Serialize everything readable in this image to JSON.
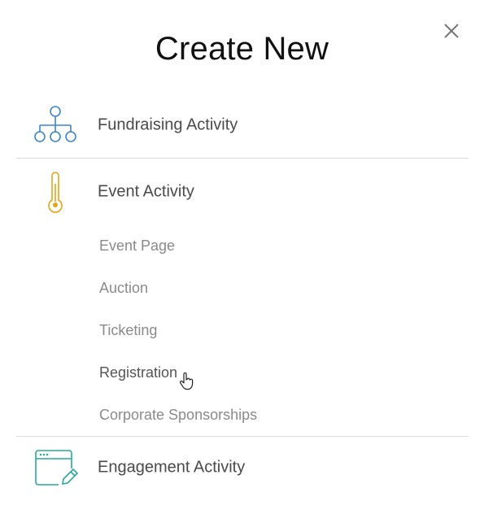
{
  "dialog": {
    "title": "Create New",
    "close_icon": "close-icon"
  },
  "options": [
    {
      "label": "Fundraising Activity",
      "icon": "org-chart-icon",
      "icon_color": "#3a86c8"
    },
    {
      "label": "Event Activity",
      "icon": "thermometer-icon",
      "icon_color": "#e8a317",
      "sub_items": [
        "Event Page",
        "Auction",
        "Ticketing",
        "Registration",
        "Corporate Sponsorships"
      ]
    },
    {
      "label": "Engagement Activity",
      "icon": "browser-edit-icon",
      "icon_color": "#2aa89a"
    }
  ]
}
